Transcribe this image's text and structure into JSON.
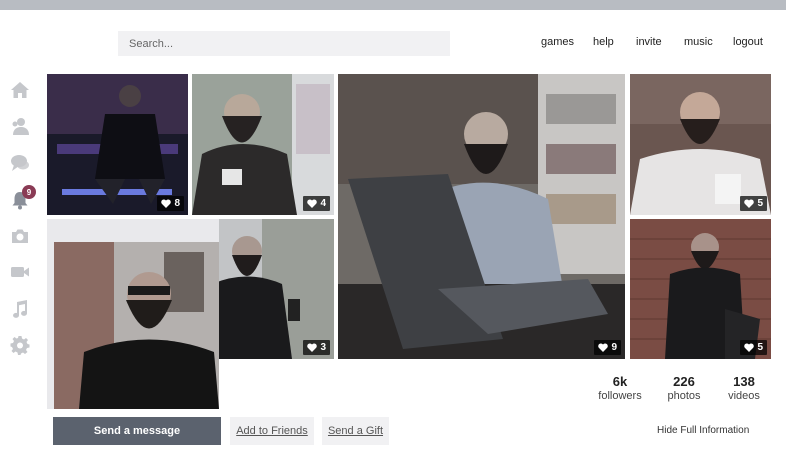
{
  "search": {
    "placeholder": "Search..."
  },
  "nav": {
    "games": "games",
    "help": "help",
    "invite": "invite",
    "music": "music",
    "logout": "logout"
  },
  "sidebar": {
    "icons": [
      "home-icon",
      "friends-icon",
      "messages-icon",
      "notifications-icon",
      "camera-icon",
      "video-icon",
      "music-icon",
      "settings-icon"
    ],
    "notification_count": "9"
  },
  "photos": [
    {
      "likes": "8"
    },
    {
      "likes": "4"
    },
    {
      "likes": "9"
    },
    {
      "likes": "5"
    },
    {
      "likes": "3"
    },
    {
      "likes": "5"
    }
  ],
  "stats": {
    "followers_value": "6k",
    "followers_label": "followers",
    "photos_value": "226",
    "photos_label": "photos",
    "videos_value": "138",
    "videos_label": "videos"
  },
  "actions": {
    "send_message": "Send a message",
    "add_friends": "Add to Friends",
    "send_gift": "Send a Gift",
    "hide_info": "Hide Full Information"
  },
  "colors": {
    "accent": "#5b626e",
    "badge": "#8a3b55",
    "topbar": "#b8bcc2",
    "sidebar_icon": "#c5c7cb"
  }
}
